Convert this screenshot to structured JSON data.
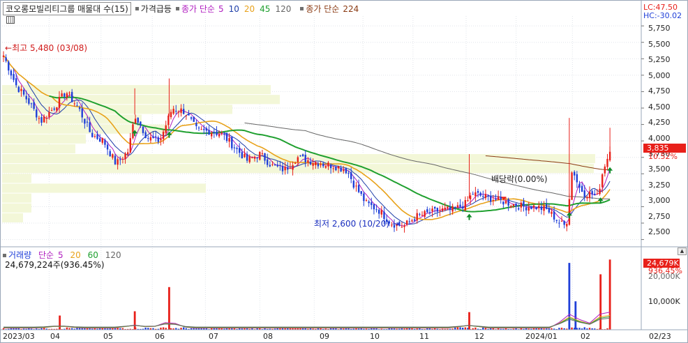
{
  "legend": {
    "stock_name": "코오롱모빌리티그룹 매물대 수(15)",
    "price_surge_label": "가격급등",
    "ma_prefix": "종가 단순",
    "ma_periods": [
      "5",
      "10",
      "20",
      "45",
      "120"
    ],
    "ma_prefix2": "종가 단순",
    "ma_period_long": "224"
  },
  "colors": {
    "up": "#e8201a",
    "down": "#1f3fd8",
    "ma5": "#b01ec0",
    "ma10": "#1f3fa8",
    "ma20": "#e8a21a",
    "ma45": "#1fa02f",
    "ma120": "#666666",
    "ma224": "#8a3a12",
    "volume_profile": "#f3f7d8",
    "grid": "#e0e4ea",
    "surge_icon": "#6f6f6f"
  },
  "top_right": {
    "lc": "LC:47.50",
    "hc": "HC:-30.02"
  },
  "price_axis": {
    "ticks": [
      "5,750",
      "5,500",
      "5,250",
      "5,000",
      "4,750",
      "4,500",
      "4,250",
      "4,000",
      "3,750",
      "3,500",
      "3,250",
      "3,000",
      "2,750",
      "2,500"
    ],
    "current_price": "3,835",
    "current_change": "10.52%"
  },
  "annotations": {
    "high": "최고 5,480 (03/08)",
    "low": "최저 2,600 (10/20)",
    "dividend": "배당락(0.00%)"
  },
  "volume_legend": {
    "title": "거래량",
    "ma_prefix": "단순",
    "periods": [
      "5",
      "20",
      "60",
      "120"
    ],
    "total": "24,679,224주(936.45%)"
  },
  "volume_axis": {
    "label_20k": "20,000K",
    "label_10k": "10,000K",
    "current_volume": "24,679K",
    "current_percent": "936.45%"
  },
  "x_axis": {
    "labels": [
      "2023/03",
      "04",
      "05",
      "06",
      "07",
      "08",
      "09",
      "10",
      "11",
      "12",
      "2024/01",
      "02",
      "02/23"
    ]
  },
  "chart_data": {
    "type": "candlestick",
    "price_range": [
      2400,
      5900
    ],
    "volume_range": [
      0,
      25000
    ],
    "price_ticks": [
      2500,
      2750,
      3000,
      3250,
      3500,
      3750,
      4000,
      4250,
      4500,
      4750,
      5000,
      5250,
      5500,
      5750
    ],
    "high": {
      "value": 5480,
      "date": "03/08"
    },
    "low": {
      "value": 2600,
      "date": "10/20"
    },
    "last_close": 3835,
    "last_change_pct": 10.52,
    "last_volume_k": 24679,
    "close_path": [
      [
        0,
        5300
      ],
      [
        0.02,
        4850
      ],
      [
        0.04,
        4600
      ],
      [
        0.06,
        4300
      ],
      [
        0.08,
        4500
      ],
      [
        0.1,
        4750
      ],
      [
        0.12,
        4500
      ],
      [
        0.14,
        4100
      ],
      [
        0.16,
        4000
      ],
      [
        0.18,
        3650
      ],
      [
        0.2,
        3850
      ],
      [
        0.21,
        4400
      ],
      [
        0.23,
        4050
      ],
      [
        0.25,
        4000
      ],
      [
        0.27,
        4500
      ],
      [
        0.29,
        4450
      ],
      [
        0.31,
        4150
      ],
      [
        0.33,
        4150
      ],
      [
        0.35,
        4100
      ],
      [
        0.37,
        3900
      ],
      [
        0.39,
        3700
      ],
      [
        0.41,
        3800
      ],
      [
        0.43,
        3620
      ],
      [
        0.45,
        3560
      ],
      [
        0.47,
        3750
      ],
      [
        0.49,
        3700
      ],
      [
        0.51,
        3650
      ],
      [
        0.53,
        3620
      ],
      [
        0.55,
        3550
      ],
      [
        0.56,
        3350
      ],
      [
        0.58,
        3050
      ],
      [
        0.6,
        2950
      ],
      [
        0.62,
        2750
      ],
      [
        0.64,
        2700
      ],
      [
        0.66,
        2850
      ],
      [
        0.68,
        2900
      ],
      [
        0.7,
        2950
      ],
      [
        0.72,
        2950
      ],
      [
        0.74,
        3050
      ],
      [
        0.75,
        3200
      ],
      [
        0.77,
        3150
      ],
      [
        0.79,
        3100
      ],
      [
        0.81,
        3050
      ],
      [
        0.83,
        3000
      ],
      [
        0.85,
        3000
      ],
      [
        0.87,
        2950
      ],
      [
        0.88,
        2850
      ],
      [
        0.89,
        2750
      ],
      [
        0.9,
        2700
      ],
      [
        0.91,
        3600
      ],
      [
        0.92,
        3300
      ],
      [
        0.93,
        3200
      ],
      [
        0.94,
        3200
      ],
      [
        0.95,
        3150
      ],
      [
        0.96,
        3600
      ],
      [
        0.97,
        3835
      ]
    ],
    "volume_spikes": [
      {
        "at": 0.09,
        "value_k": 5000
      },
      {
        "at": 0.21,
        "value_k": 6500
      },
      {
        "at": 0.265,
        "value_k": 15000
      },
      {
        "at": 0.745,
        "value_k": 6200
      },
      {
        "at": 0.905,
        "value_k": 23500
      },
      {
        "at": 0.915,
        "value_k": 10000
      },
      {
        "at": 0.955,
        "value_k": 19500
      },
      {
        "at": 0.97,
        "value_k": 24679
      }
    ]
  }
}
